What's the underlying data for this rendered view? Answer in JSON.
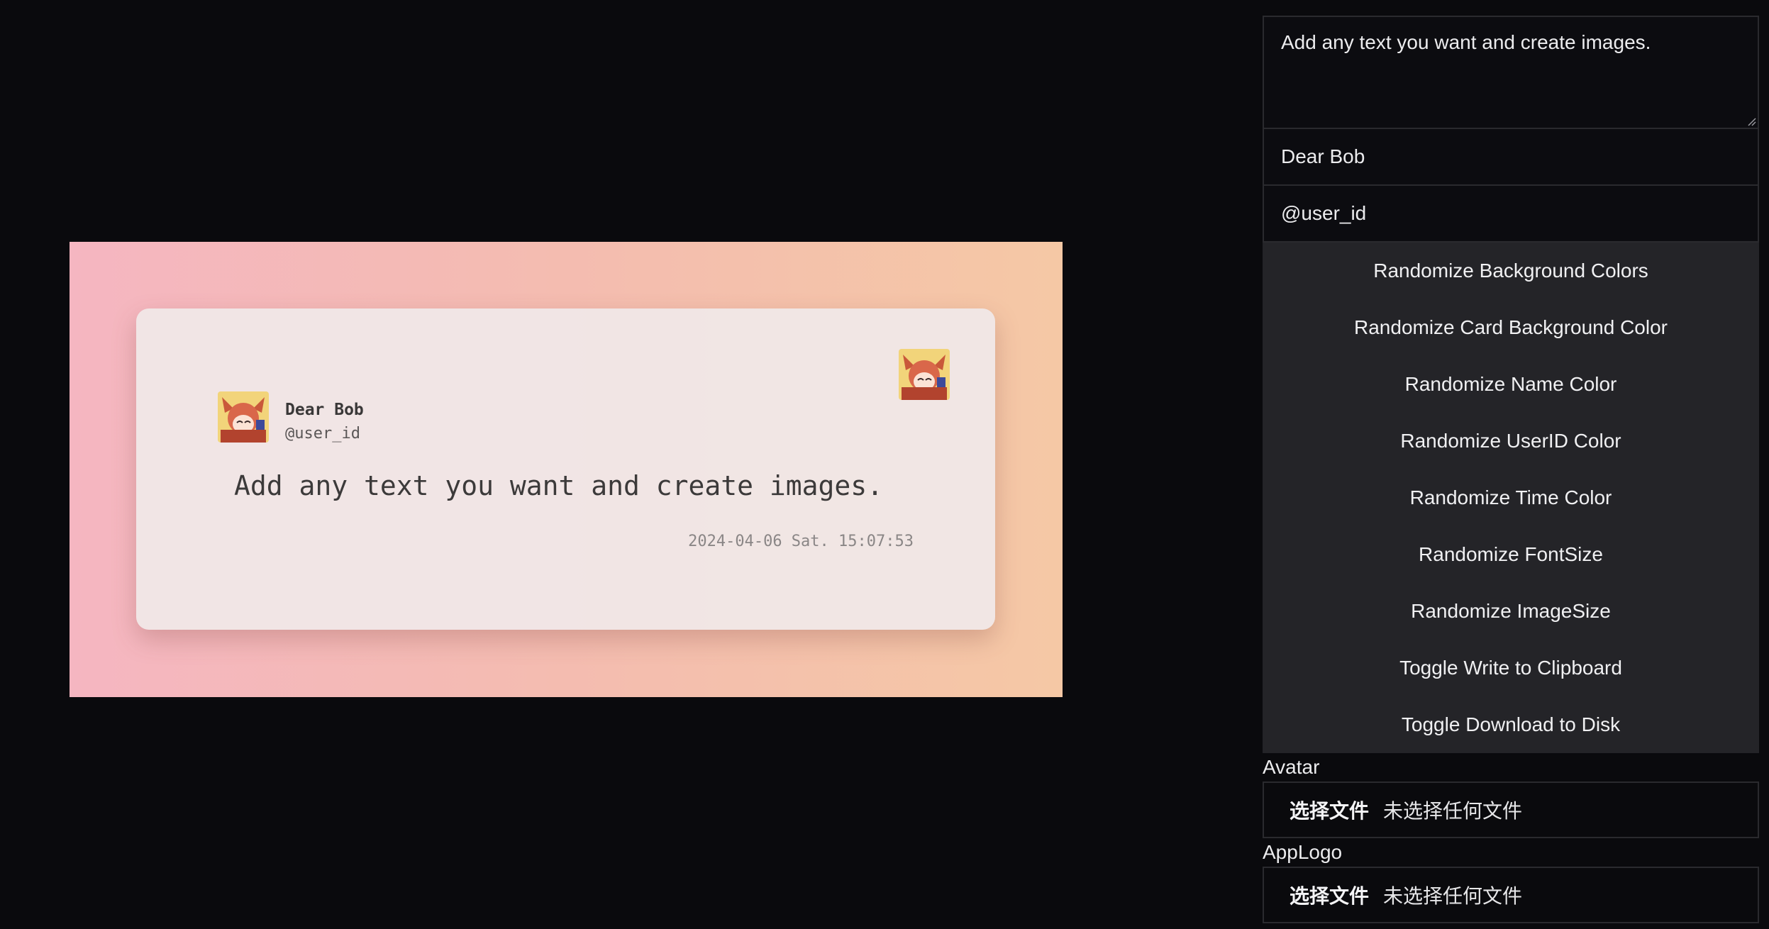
{
  "card": {
    "name": "Dear Bob",
    "userid": "@user_id",
    "text": "Add any text you want and create images.",
    "time": "2024-04-06 Sat. 15:07:53"
  },
  "form": {
    "text_value": "Add any text you want and create images.",
    "name_value": "Dear Bob",
    "userid_value": "@user_id"
  },
  "buttons": {
    "randomize_bg": "Randomize Background Colors",
    "randomize_card_bg": "Randomize Card Background Color",
    "randomize_name_color": "Randomize Name Color",
    "randomize_userid_color": "Randomize UserID Color",
    "randomize_time_color": "Randomize Time Color",
    "randomize_fontsize": "Randomize FontSize",
    "randomize_imagesize": "Randomize ImageSize",
    "toggle_clipboard": "Toggle Write to Clipboard",
    "toggle_download": "Toggle Download to Disk"
  },
  "uploads": {
    "avatar_label": "Avatar",
    "applogo_label": "AppLogo",
    "choose_file": "选择文件",
    "no_file": "未选择任何文件"
  },
  "colors": {
    "page_bg": "#0a0a0d",
    "gradient_start": "#f5b6c1",
    "gradient_end": "#f5c8a5",
    "button_group_bg": "#242428"
  },
  "icons": {
    "avatar": "anime-avatar-icon",
    "applogo": "anime-applogo-icon"
  }
}
